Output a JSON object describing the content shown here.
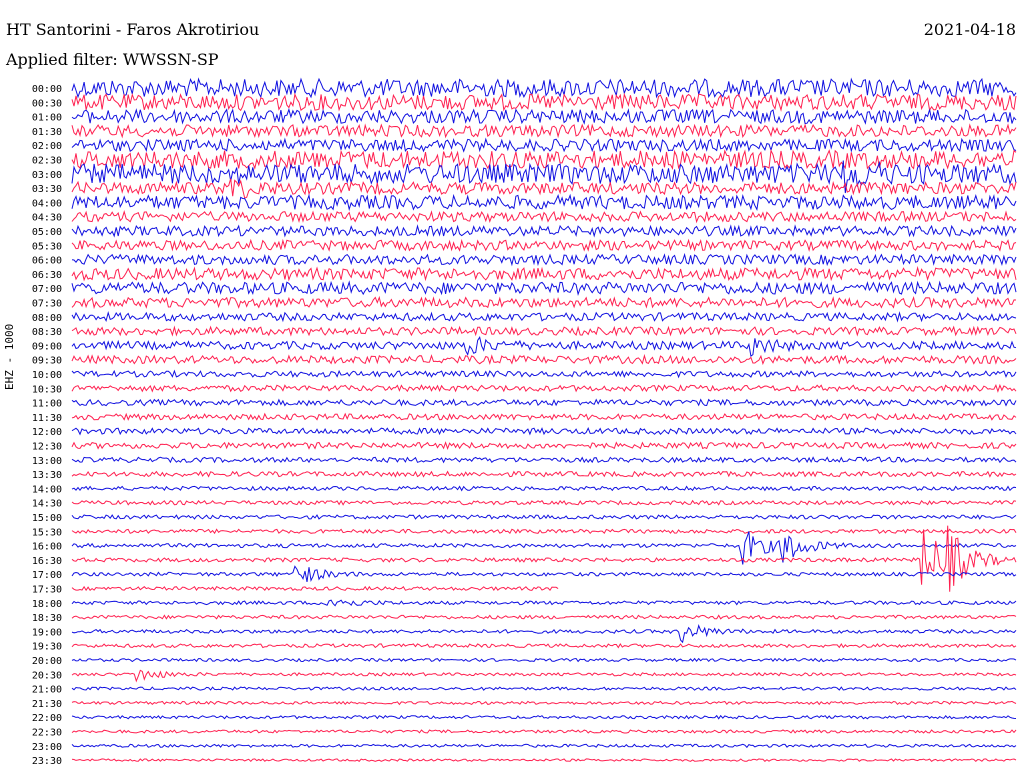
{
  "header": {
    "title": "HT Santorini - Faros Akrotiriou",
    "date": "2021-04-18",
    "filter": "Applied filter: WWSSN-SP"
  },
  "chart_data": {
    "type": "line",
    "subtype": "helicorder",
    "channel_label": "EHZ - 1000",
    "rows": [
      "00:00",
      "00:30",
      "01:00",
      "01:30",
      "02:00",
      "02:30",
      "03:00",
      "03:30",
      "04:00",
      "04:30",
      "05:00",
      "05:30",
      "06:00",
      "06:30",
      "07:00",
      "07:30",
      "08:00",
      "08:30",
      "09:00",
      "09:30",
      "10:00",
      "10:30",
      "11:00",
      "11:30",
      "12:00",
      "12:30",
      "13:00",
      "13:30",
      "14:00",
      "14:30",
      "15:00",
      "15:30",
      "16:00",
      "16:30",
      "17:00",
      "17:30",
      "18:00",
      "18:30",
      "19:00",
      "19:30",
      "20:00",
      "20:30",
      "21:00",
      "21:30",
      "22:00",
      "22:30",
      "23:00",
      "23:30"
    ],
    "row_colors": [
      "#1010e0",
      "#ff1f4f"
    ],
    "noise_amplitude": [
      9,
      8,
      7,
      6,
      6,
      9,
      10,
      6,
      7,
      5,
      5,
      5,
      5,
      6,
      6,
      5,
      4,
      4,
      4,
      4,
      3,
      3,
      3,
      3,
      3,
      3,
      2.5,
      2.5,
      2,
      2,
      2,
      2,
      2,
      2,
      1.8,
      1.8,
      1.8,
      1.8,
      1.8,
      1.8,
      1.5,
      1.5,
      1.5,
      1.5,
      1.5,
      1.5,
      1.5,
      1.2
    ],
    "events": [
      {
        "row": 32,
        "minute": 21.2,
        "amplitude": 22
      },
      {
        "row": 32,
        "minute": 22.5,
        "amplitude": 20
      },
      {
        "row": 33,
        "minute": 27.0,
        "amplitude": 40
      },
      {
        "row": 33,
        "minute": 27.8,
        "amplitude": 26
      },
      {
        "row": 34,
        "minute": 7.0,
        "amplitude": 14
      },
      {
        "row": 36,
        "minute": 8.0,
        "amplitude": 8
      },
      {
        "row": 38,
        "minute": 19.3,
        "amplitude": 12
      },
      {
        "row": 41,
        "minute": 2.0,
        "amplitude": 8
      },
      {
        "row": 18,
        "minute": 12.5,
        "amplitude": 9
      },
      {
        "row": 18,
        "minute": 21.5,
        "amplitude": 10
      },
      {
        "row": 6,
        "minute": 24.5,
        "amplitude": 12
      },
      {
        "row": 7,
        "minute": 5.0,
        "amplitude": 10
      }
    ],
    "gap": {
      "row": 35,
      "from_minute": 15.5,
      "to_minute": 30
    },
    "grid": false,
    "legend": "none"
  }
}
